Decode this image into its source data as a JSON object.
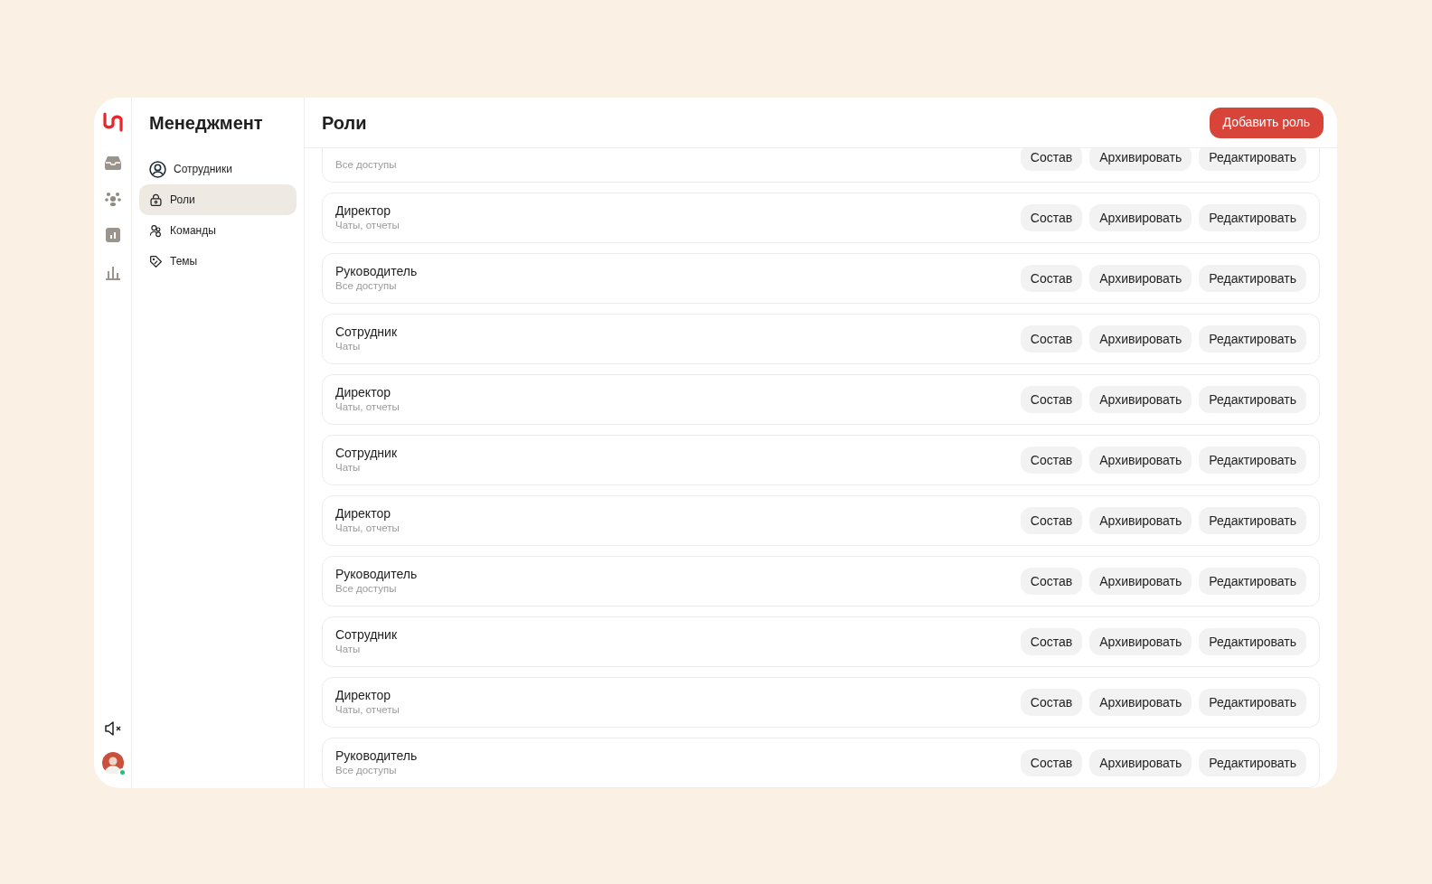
{
  "section": {
    "title": "Менеджмент",
    "items": [
      {
        "label": "Сотрудники",
        "selected": false
      },
      {
        "label": "Роли",
        "selected": true
      },
      {
        "label": "Команды",
        "selected": false
      },
      {
        "label": "Темы",
        "selected": false
      }
    ]
  },
  "user": {
    "online": true
  },
  "header": {
    "title": "Роли",
    "add_button": "Добавить роль"
  },
  "roles": [
    {
      "subtitle": "Все доступы",
      "actions": [
        "Состав",
        "Архивировать",
        "Редактировать"
      ]
    },
    {
      "title": "Директор",
      "subtitle": "Чаты, отчеты",
      "actions": [
        "Состав",
        "Архивировать",
        "Редактировать"
      ]
    },
    {
      "title": "Руководитель",
      "subtitle": "Все доступы",
      "actions": [
        "Состав",
        "Архивировать",
        "Редактировать"
      ]
    },
    {
      "title": "Сотрудник",
      "subtitle": "Чаты",
      "actions": [
        "Состав",
        "Архивировать",
        "Редактировать"
      ]
    },
    {
      "title": "Директор",
      "subtitle": "Чаты, отчеты",
      "actions": [
        "Состав",
        "Архивировать",
        "Редактировать"
      ]
    },
    {
      "title": "Сотрудник",
      "subtitle": "Чаты",
      "actions": [
        "Состав",
        "Архивировать",
        "Редактировать"
      ]
    },
    {
      "title": "Директор",
      "subtitle": "Чаты, отчеты",
      "actions": [
        "Состав",
        "Архивировать",
        "Редактировать"
      ]
    },
    {
      "title": "Руководитель",
      "subtitle": "Все доступы",
      "actions": [
        "Состав",
        "Архивировать",
        "Редактировать"
      ]
    },
    {
      "title": "Сотрудник",
      "subtitle": "Чаты",
      "actions": [
        "Состав",
        "Архивировать",
        "Редактировать"
      ]
    },
    {
      "title": "Директор",
      "subtitle": "Чаты, отчеты",
      "actions": [
        "Состав",
        "Архивировать",
        "Редактировать"
      ]
    },
    {
      "title": "Руководитель",
      "subtitle": "Все доступы",
      "actions": [
        "Состав",
        "Архивировать",
        "Редактировать"
      ]
    }
  ]
}
